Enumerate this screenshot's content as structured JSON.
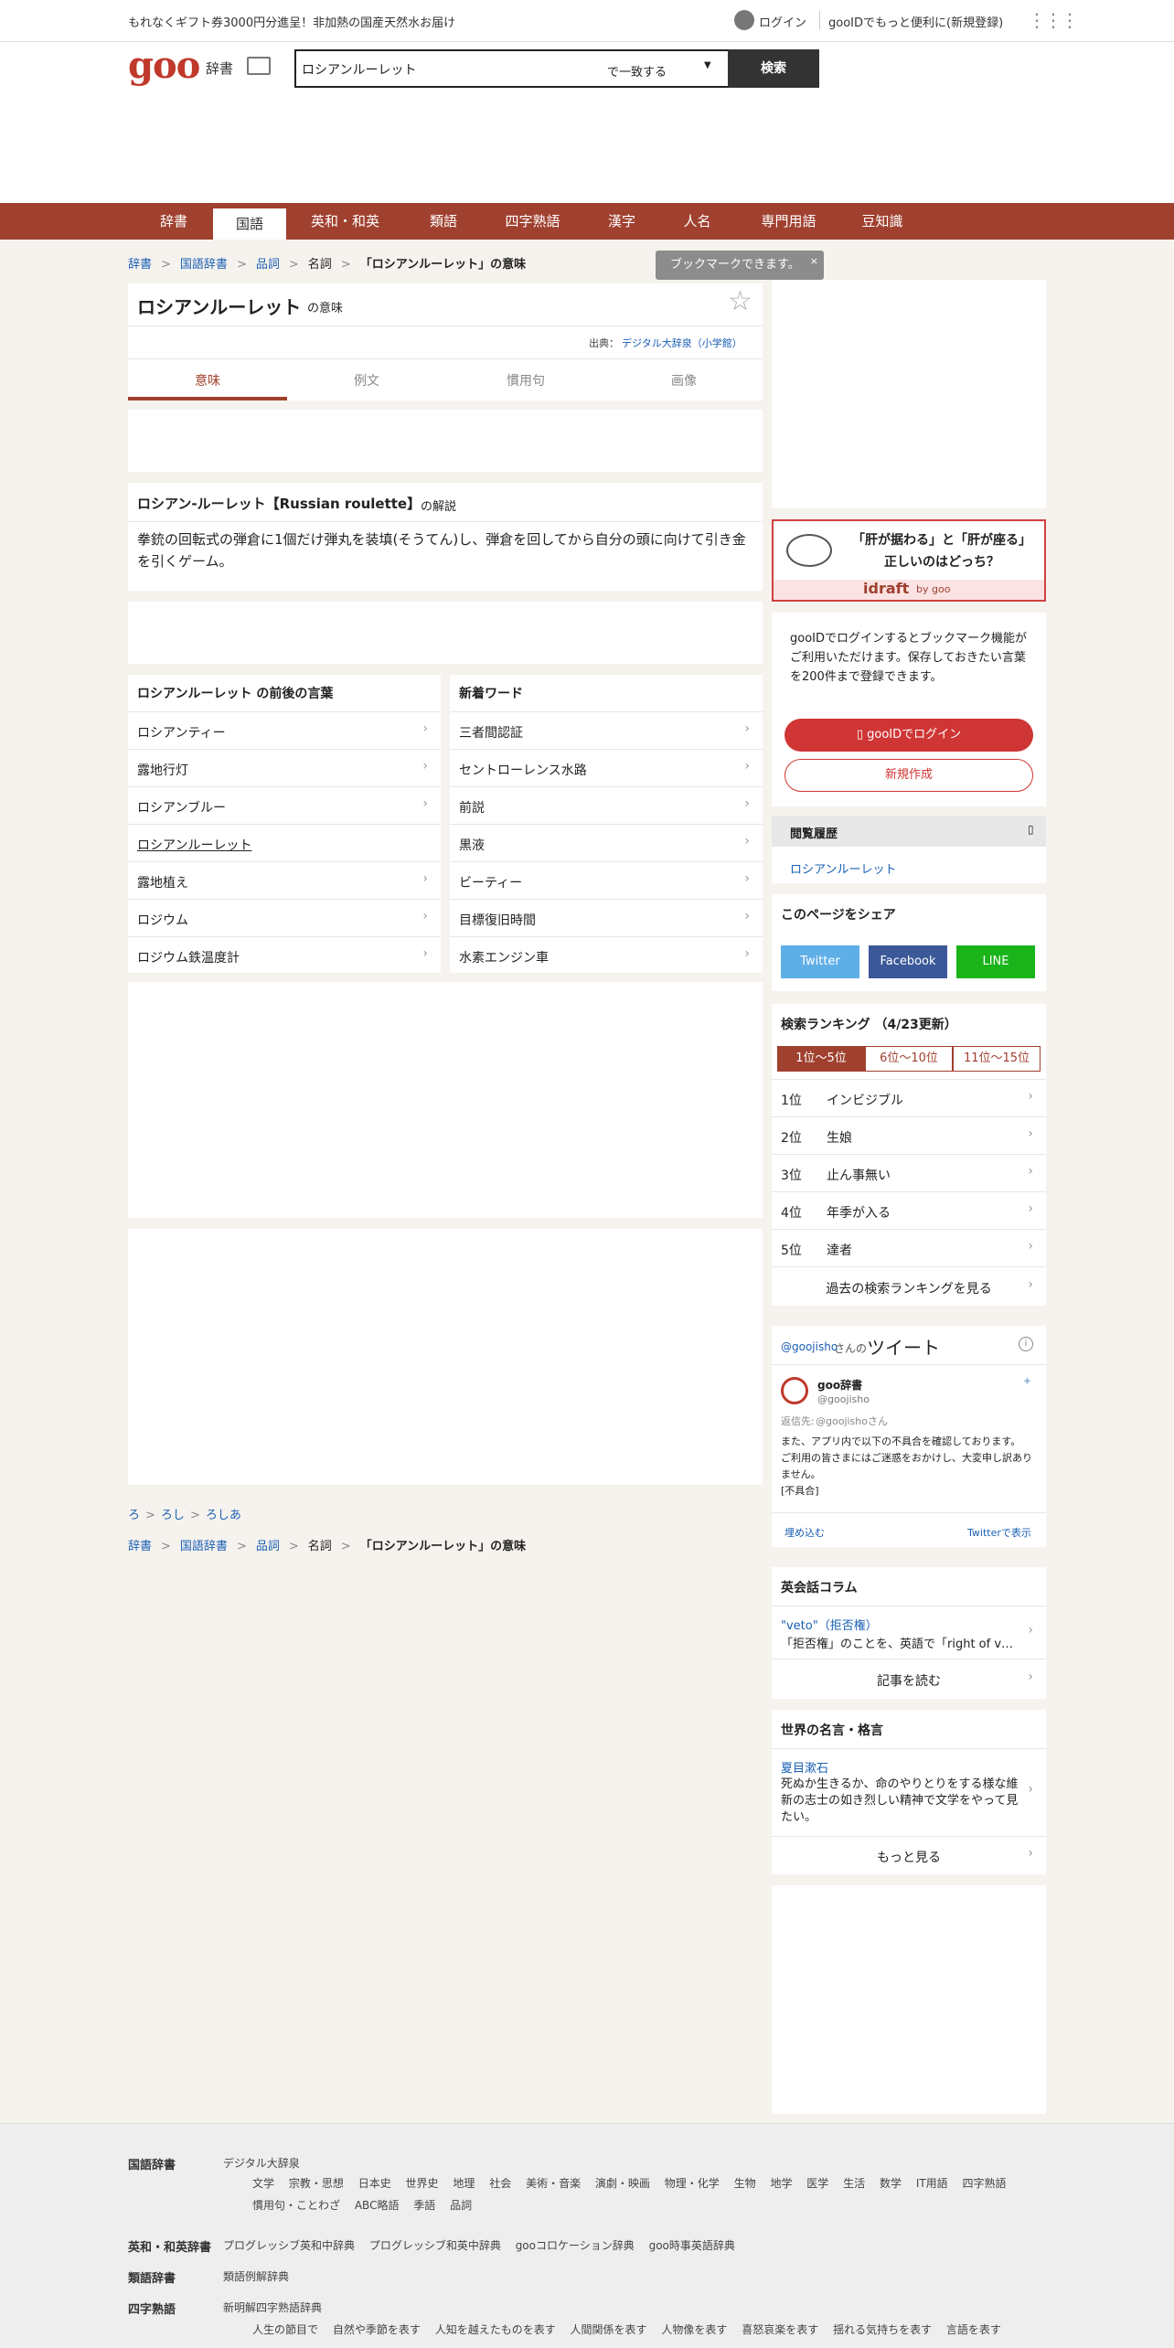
{
  "topbar": {
    "promo": "もれなくギフト券3000円分進呈！非加熱の国産天然水お届け",
    "login": "ログイン",
    "register": "gooIDでもっと便利に(新規登録)"
  },
  "header": {
    "logo": "goo",
    "dict_label": "辞書",
    "search_value": "ロシアンルーレット",
    "match_mode": "で一致する",
    "search_button": "検索"
  },
  "nav": [
    "辞書",
    "国語",
    "英和・和英",
    "類語",
    "四字熟語",
    "漢字",
    "人名",
    "専門用語",
    "豆知識"
  ],
  "breadcrumb": {
    "items": [
      "辞書",
      "国語辞書",
      "品詞"
    ],
    "plain": "名詞",
    "current": "「ロシアンルーレット」の意味",
    "tooltip": "ブックマークできます。"
  },
  "entry": {
    "title": "ロシアンルーレット",
    "title_suffix": "の意味",
    "source_label": "出典：",
    "source": "デジタル大辞泉（小学館）",
    "tabs": [
      "意味",
      "例文",
      "慣用句",
      "画像"
    ],
    "heading": "ロシアン‐ルーレット【Russian roulette】",
    "heading_suffix": "の解説",
    "body": "拳銃の回転式の弾倉に1個だけ弾丸を装填(そうてん)し、弾倉を回してから自分の頭に向けて引き金を引くゲーム。"
  },
  "nearby": {
    "title": "ロシアンルーレット の前後の言葉",
    "items": [
      "ロシアンティー",
      "露地行灯",
      "ロシアンブルー",
      "ロシアンルーレット",
      "露地植え",
      "ロジウム",
      "ロジウム鉄温度計"
    ]
  },
  "newwords": {
    "title": "新着ワード",
    "items": [
      "三者間認証",
      "セントローレンス水路",
      "前説",
      "黒液",
      "ビーティー",
      "目標復旧時間",
      "水素エンジン車"
    ]
  },
  "kana_crumb": [
    "ろ",
    "ろし",
    "ろしあ"
  ],
  "ad": {
    "line1": "「肝が据わる」と「肝が座る」",
    "line2": "正しいのはどっち？",
    "brand": "idraft",
    "brand_sub": "by goo"
  },
  "login_box": {
    "text": "gooIDでログインするとブックマーク機能がご利用いただけます。保存しておきたい言葉を200件まで登録できます。",
    "login_button": "gooIDでログイン",
    "register_button": "新規作成"
  },
  "history": {
    "title": "閲覧履歴",
    "items": [
      "ロシアンルーレット"
    ]
  },
  "share": {
    "title": "このページをシェア",
    "twitter": "Twitter",
    "facebook": "Facebook",
    "line": "LINE"
  },
  "ranking": {
    "title": "検索ランキング （4/23更新）",
    "tabs": [
      "1位～5位",
      "6位～10位",
      "11位～15位"
    ],
    "items": [
      {
        "rank": "1位",
        "word": "インビジブル"
      },
      {
        "rank": "2位",
        "word": "生娘"
      },
      {
        "rank": "3位",
        "word": "止ん事無い"
      },
      {
        "rank": "4位",
        "word": "年季が入る"
      },
      {
        "rank": "5位",
        "word": "達者"
      }
    ],
    "more": "過去の検索ランキングを見る"
  },
  "tweet": {
    "handle": "@goojisho",
    "handle_suffix": "さんの",
    "heading": "ツイート",
    "account": "goo辞書",
    "account_id": "@goojisho",
    "reply_prefix": "返信先:",
    "reply_to": "@goojishoさん",
    "text": "また、アプリ内で以下の不具合を確認しております。\nご利用の皆さまにはご迷惑をおかけし、大変申し訳ありません。\n[不具合]",
    "embed": "埋め込む",
    "view": "Twitterで表示"
  },
  "column": {
    "title": "英会話コラム",
    "link": "\"veto\"（拒否権）",
    "text": "「拒否権」のことを、英語で「right of v…",
    "more": "記事を読む"
  },
  "quotes": {
    "title": "世界の名言・格言",
    "author": "夏目漱石",
    "text": "死ぬか生きるか、命のやりとりをする様な維新の志士の如き烈しい精神で文学をやって見たい。",
    "more": "もっと見る"
  },
  "footer": {
    "kokugo_label": "国語辞書",
    "kokugo_main": "デジタル大辞泉",
    "kokugo_sub1": [
      "文学",
      "宗教・思想",
      "日本史",
      "世界史",
      "地理",
      "社会",
      "美術・音楽",
      "演劇・映画",
      "物理・化学",
      "生物",
      "地学",
      "医学",
      "生活",
      "数学",
      "IT用語",
      "四字熟語"
    ],
    "kokugo_sub2": [
      "慣用句・ことわざ",
      "ABC略語",
      "季語",
      "品詞"
    ],
    "eiwa_label": "英和・和英辞書",
    "eiwa": [
      "プログレッシブ英和中辞典",
      "プログレッシブ和英中辞典",
      "gooコロケーション辞典",
      "goo時事英語辞典"
    ],
    "ruigo_label": "類語辞書",
    "ruigo": [
      "類語例解辞典"
    ],
    "yoji_label": "四字熟語",
    "yoji_main": "新明解四字熟語辞典",
    "yoji_sub": [
      "人生の節目で",
      "自然や季節を表す",
      "人知を越えたものを表す",
      "人間関係を表す",
      "人物像を表す",
      "喜怒哀楽を表す",
      "揺れる気持ちを表す",
      "言語を表す"
    ]
  }
}
